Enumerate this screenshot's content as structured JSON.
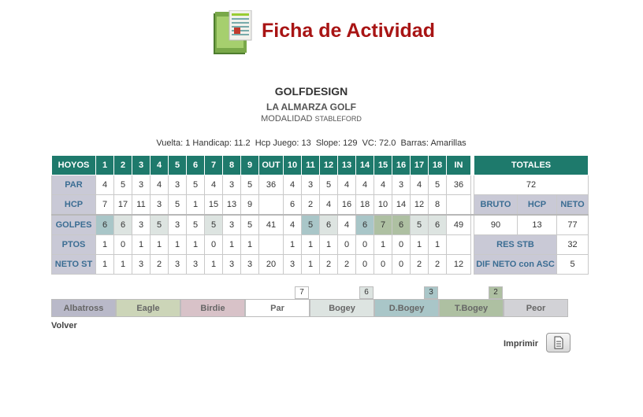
{
  "header": {
    "title": "Ficha de Actividad",
    "logo_icon": "golf-course-card-icon"
  },
  "player": {
    "name": "GOLFDESIGN",
    "club": "LA ALMARZA GOLF",
    "modality_label": "MODALIDAD",
    "modality_value": "STABLEFORD"
  },
  "stats": {
    "vuelta_label": "Vuelta:",
    "vuelta": "1",
    "handicap_label": "Handicap:",
    "handicap": "11.2",
    "hcp_juego_label": "Hcp Juego:",
    "hcp_juego": "13",
    "slope_label": "Slope:",
    "slope": "129",
    "vc_label": "VC:",
    "vc": "72.0",
    "barras_label": "Barras:",
    "barras": "Amarillas"
  },
  "scorecard": {
    "header": [
      "HOYOS",
      "1",
      "2",
      "3",
      "4",
      "5",
      "6",
      "7",
      "8",
      "9",
      "OUT",
      "10",
      "11",
      "12",
      "13",
      "14",
      "15",
      "16",
      "17",
      "18",
      "IN"
    ],
    "totales_label": "TOTALES",
    "rows": {
      "par": {
        "label": "PAR",
        "values": [
          "4",
          "5",
          "3",
          "4",
          "3",
          "5",
          "4",
          "3",
          "5",
          "36",
          "4",
          "3",
          "5",
          "4",
          "4",
          "4",
          "3",
          "4",
          "5",
          "36"
        ]
      },
      "hcp": {
        "label": "HCP",
        "values": [
          "7",
          "17",
          "11",
          "3",
          "5",
          "1",
          "15",
          "13",
          "9",
          "",
          "6",
          "2",
          "4",
          "16",
          "18",
          "10",
          "14",
          "12",
          "8",
          ""
        ]
      },
      "golpes": {
        "label": "GOLPES",
        "values": [
          "6",
          "6",
          "3",
          "5",
          "3",
          "5",
          "5",
          "3",
          "5",
          "41",
          "4",
          "5",
          "6",
          "4",
          "6",
          "7",
          "6",
          "5",
          "6",
          "49"
        ]
      },
      "ptos": {
        "label": "PTOS",
        "values": [
          "1",
          "0",
          "1",
          "1",
          "1",
          "1",
          "0",
          "1",
          "1",
          "",
          "1",
          "1",
          "1",
          "0",
          "0",
          "1",
          "0",
          "1",
          "1",
          ""
        ]
      },
      "neto": {
        "label": "NETO ST",
        "values": [
          "1",
          "1",
          "3",
          "2",
          "3",
          "3",
          "1",
          "3",
          "3",
          "20",
          "3",
          "1",
          "2",
          "2",
          "0",
          "0",
          "0",
          "2",
          "2",
          "12"
        ]
      }
    },
    "totals": {
      "par_total": "72",
      "bruto_label": "BRUTO",
      "hcp_label": "HCP",
      "neto_label": "NETO",
      "bruto": "90",
      "hcp": "13",
      "neto": "77",
      "res_stb_label": "RES STB",
      "res_stb": "32",
      "dif_label": "DIF NETO con ASC",
      "dif": "5"
    }
  },
  "legend": [
    {
      "label": "Albatross",
      "count": "",
      "color": "#b9b9c9"
    },
    {
      "label": "Eagle",
      "count": "",
      "color": "#ccd5b8"
    },
    {
      "label": "Birdie",
      "count": "",
      "color": "#d8c2c8"
    },
    {
      "label": "Par",
      "count": "7",
      "color": "#ffffff"
    },
    {
      "label": "Bogey",
      "count": "6",
      "color": "#dde4e1"
    },
    {
      "label": "D.Bogey",
      "count": "3",
      "color": "#a9c6c8"
    },
    {
      "label": "T.Bogey",
      "count": "2",
      "color": "#aec0a2"
    },
    {
      "label": "Peor",
      "count": "",
      "color": "#d2d2d6"
    }
  ],
  "links": {
    "volver": "Volver",
    "imprimir": "Imprimir",
    "print_icon": "document-print-icon"
  }
}
